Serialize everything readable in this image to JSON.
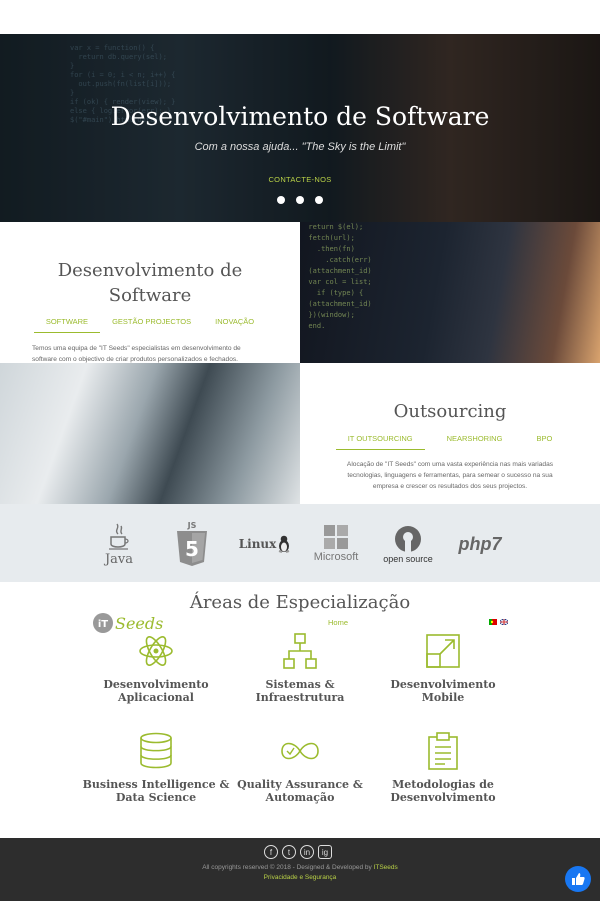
{
  "hero": {
    "title": "Desenvolvimento de Software",
    "subtitle": "Com a nossa ajuda... \"The Sky is the Limit\"",
    "cta": "CONTACTE-NOS",
    "slides": 3
  },
  "software": {
    "title_line1": "Desenvolvimento de",
    "title_line2": "Software",
    "tabs": [
      "SOFTWARE",
      "GESTÃO PROJECTOS",
      "INOVAÇÃO"
    ],
    "text_line1": "Temos uma equipa de \"IT Seeds\" especialistas em desenvolvimento de",
    "text_line2": "software com o objectivo de criar produtos personalizados e fechados."
  },
  "outsourcing": {
    "title": "Outsourcing",
    "tabs": [
      "IT OUTSOURCING",
      "NEARSHORING",
      "BPO"
    ],
    "text_line1": "Alocação de \"IT Seeds\" com uma vasta experiência nas mais variadas",
    "text_line2": "tecnologias, linguagens e ferramentas, para semear o sucesso na sua",
    "text_line3": "empresa e crescer os resultados dos seus projectos."
  },
  "logos": {
    "java": "Java",
    "html5": "5",
    "linux": "Linux",
    "microsoft": "Microsoft",
    "opensource": "open source",
    "php": "php7"
  },
  "areas": {
    "title": "Áreas de Especialização",
    "brand": "Seeds",
    "home": "Home",
    "items": [
      {
        "line1": "Desenvolvimento",
        "line2": "Aplicacional"
      },
      {
        "line1": "Sistemas &",
        "line2": "Infraestrutura"
      },
      {
        "line1": "Desenvolvimento",
        "line2": "Mobile"
      },
      {
        "line1": "Business Intelligence &",
        "line2": "Data Science"
      },
      {
        "line1": "Quality Assurance &",
        "line2": "Automação"
      },
      {
        "line1": "Metodologias de",
        "line2": "Desenvolvimento"
      }
    ]
  },
  "footer": {
    "copyright": "All copyrights reserved © 2018 - Designed & Developed by ",
    "brand": "ITSeeds",
    "privacy": "Privacidade e Segurança",
    "social": [
      "f",
      "t",
      "in",
      "ig"
    ]
  },
  "colors": {
    "accent": "#9bbb2e",
    "footer_bg": "#2d2d2d",
    "logos_bg": "#e7ebee",
    "facebook": "#1877f2"
  }
}
